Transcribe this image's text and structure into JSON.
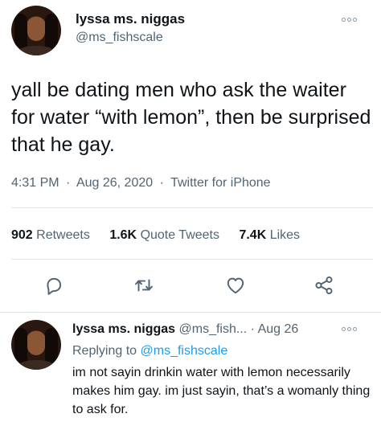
{
  "tweet": {
    "author_name": "lyssa ms. niggas",
    "author_handle": "@ms_fishscale",
    "text": "yall be dating men who ask the waiter for water “with lemon”, then be surprised that he gay.",
    "time": "4:31 PM",
    "date": "Aug 26, 2020",
    "source": "Twitter for iPhone",
    "separator": "·"
  },
  "stats": {
    "retweets_count": "902",
    "retweets_label": "Retweets",
    "quotes_count": "1.6K",
    "quotes_label": "Quote Tweets",
    "likes_count": "7.4K",
    "likes_label": "Likes"
  },
  "actions": {
    "icons": [
      "reply-icon",
      "retweet-icon",
      "like-icon",
      "share-icon"
    ],
    "icon_color": "#536471"
  },
  "reply": {
    "author_name": "lyssa ms. niggas",
    "author_handle_trunc": "@ms_fish...",
    "separator": "·",
    "date": "Aug 26",
    "replying_to_label": "Replying to",
    "replying_to_handle": "@ms_fishscale",
    "text": "im not sayin drinkin water with lemon necessarily makes him gay. im just sayin, that’s a womanly thing to ask for."
  },
  "colors": {
    "text": "#0f1419",
    "secondary": "#536471",
    "link": "#1d9bf0",
    "divider": "#dfe4e8"
  }
}
